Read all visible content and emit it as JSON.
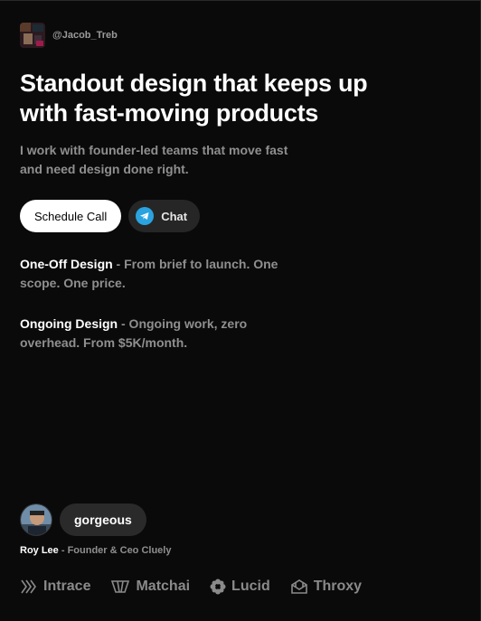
{
  "profile": {
    "handle": "@Jacob_Treb"
  },
  "hero": {
    "headline": "Standout design that keeps up with fast-moving products",
    "subhead": "I work with founder-led teams that move fast and need design done right."
  },
  "actions": {
    "primary_label": "Schedule Call",
    "secondary_label": "Chat",
    "secondary_icon": "telegram-icon"
  },
  "offers": [
    {
      "label": "One-Off Design",
      "desc": " - From brief to launch. One scope. One price."
    },
    {
      "label": "Ongoing Design",
      "desc": " - Ongoing work, zero overhead. From $5K/month."
    }
  ],
  "testimonial": {
    "quote": "gorgeous",
    "name": "Roy Lee",
    "role": " - Founder & Ceo Cluely"
  },
  "logos": [
    {
      "name": "Intrace",
      "icon": "intrace-icon"
    },
    {
      "name": "Matchai",
      "icon": "matchai-icon"
    },
    {
      "name": "Lucid",
      "icon": "lucid-icon"
    },
    {
      "name": "Throxy",
      "icon": "throxy-icon"
    }
  ],
  "colors": {
    "background": "#0a0a0a",
    "muted_text": "#8f8f8f",
    "telegram": "#2aa3e0"
  }
}
